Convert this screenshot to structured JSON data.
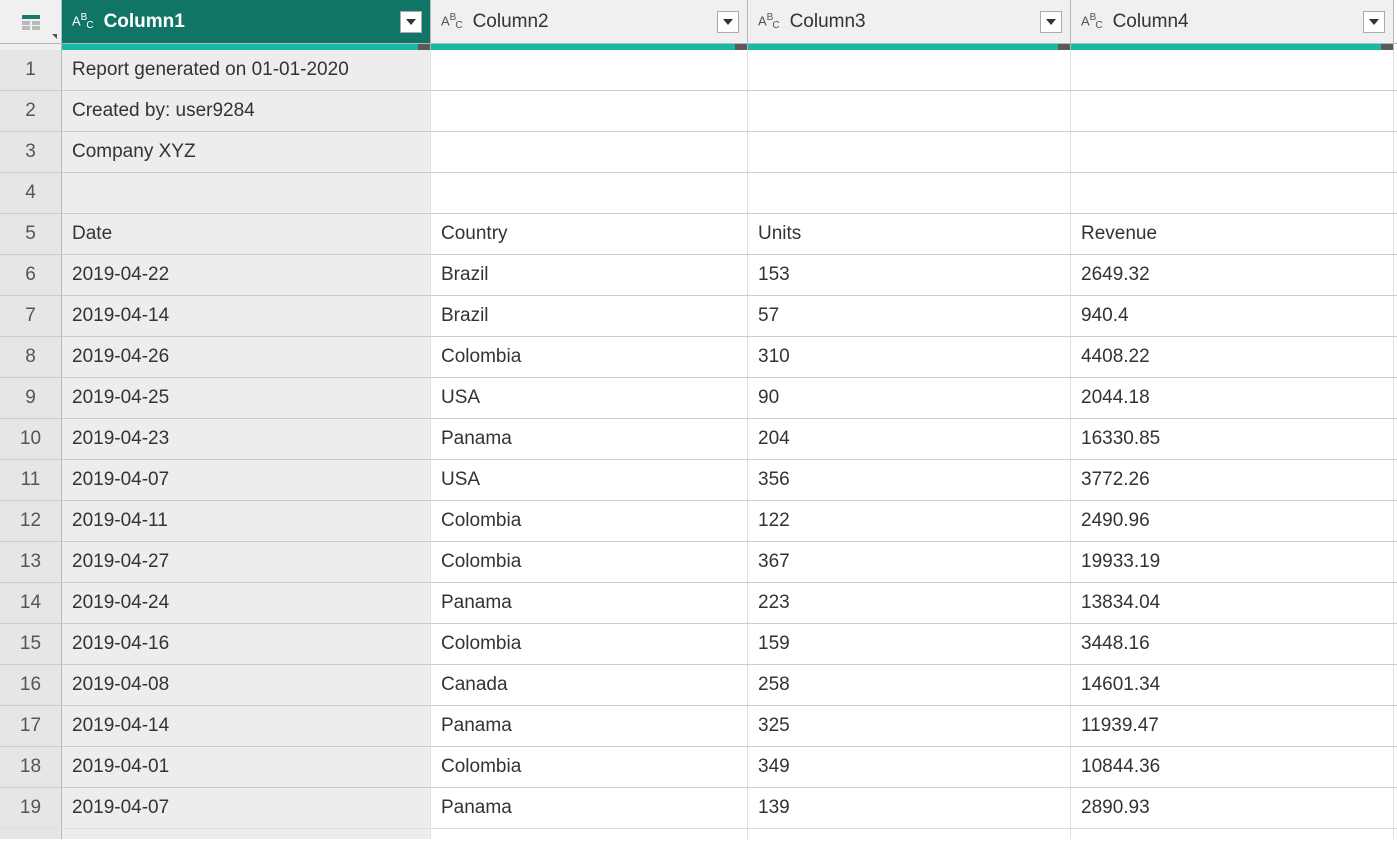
{
  "columns": [
    {
      "name": "Column1",
      "selected": true
    },
    {
      "name": "Column2",
      "selected": false
    },
    {
      "name": "Column3",
      "selected": false
    },
    {
      "name": "Column4",
      "selected": false
    }
  ],
  "rows": [
    {
      "n": "1",
      "c": [
        "Report generated on 01-01-2020",
        "",
        "",
        ""
      ]
    },
    {
      "n": "2",
      "c": [
        "Created by: user9284",
        "",
        "",
        ""
      ]
    },
    {
      "n": "3",
      "c": [
        "Company XYZ",
        "",
        "",
        ""
      ]
    },
    {
      "n": "4",
      "c": [
        "",
        "",
        "",
        ""
      ]
    },
    {
      "n": "5",
      "c": [
        "Date",
        "Country",
        "Units",
        "Revenue"
      ]
    },
    {
      "n": "6",
      "c": [
        "2019-04-22",
        "Brazil",
        "153",
        "2649.32"
      ]
    },
    {
      "n": "7",
      "c": [
        "2019-04-14",
        "Brazil",
        "57",
        "940.4"
      ]
    },
    {
      "n": "8",
      "c": [
        "2019-04-26",
        "Colombia",
        "310",
        "4408.22"
      ]
    },
    {
      "n": "9",
      "c": [
        "2019-04-25",
        "USA",
        "90",
        "2044.18"
      ]
    },
    {
      "n": "10",
      "c": [
        "2019-04-23",
        "Panama",
        "204",
        "16330.85"
      ]
    },
    {
      "n": "11",
      "c": [
        "2019-04-07",
        "USA",
        "356",
        "3772.26"
      ]
    },
    {
      "n": "12",
      "c": [
        "2019-04-11",
        "Colombia",
        "122",
        "2490.96"
      ]
    },
    {
      "n": "13",
      "c": [
        "2019-04-27",
        "Colombia",
        "367",
        "19933.19"
      ]
    },
    {
      "n": "14",
      "c": [
        "2019-04-24",
        "Panama",
        "223",
        "13834.04"
      ]
    },
    {
      "n": "15",
      "c": [
        "2019-04-16",
        "Colombia",
        "159",
        "3448.16"
      ]
    },
    {
      "n": "16",
      "c": [
        "2019-04-08",
        "Canada",
        "258",
        "14601.34"
      ]
    },
    {
      "n": "17",
      "c": [
        "2019-04-14",
        "Panama",
        "325",
        "11939.47"
      ]
    },
    {
      "n": "18",
      "c": [
        "2019-04-01",
        "Colombia",
        "349",
        "10844.36"
      ]
    },
    {
      "n": "19",
      "c": [
        "2019-04-07",
        "Panama",
        "139",
        "2890.93"
      ]
    }
  ]
}
